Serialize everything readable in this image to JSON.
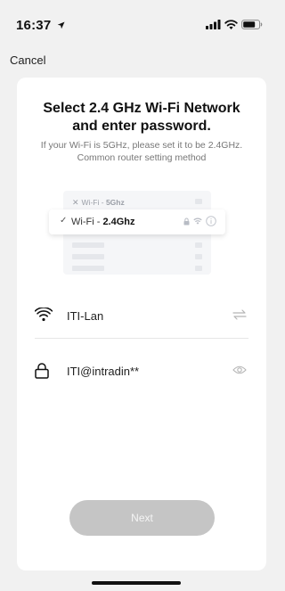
{
  "status_bar": {
    "time": "16:37"
  },
  "nav": {
    "cancel_label": "Cancel"
  },
  "card": {
    "title": "Select 2.4 GHz Wi-Fi Network and enter password.",
    "subtitle": "If your Wi-Fi is 5GHz, please set it to be 2.4GHz. Common router setting method"
  },
  "illustration": {
    "row_5g_prefix": "Wi-Fi - ",
    "row_5g_band": "5Ghz",
    "row_24_prefix": "Wi-Fi - ",
    "row_24_band": "2.4Ghz"
  },
  "wifi": {
    "ssid": "ITI-Lan",
    "password": "ITI@intradin**"
  },
  "actions": {
    "next_label": "Next"
  },
  "colors": {
    "background": "#f1f1f1",
    "card": "#ffffff",
    "button_disabled": "#c5c5c5"
  },
  "icons": [
    "location-arrow-icon",
    "signal-icon",
    "wifi-icon",
    "battery-icon",
    "lock-icon",
    "switch-icon",
    "eye-icon",
    "info-icon",
    "check-icon"
  ]
}
